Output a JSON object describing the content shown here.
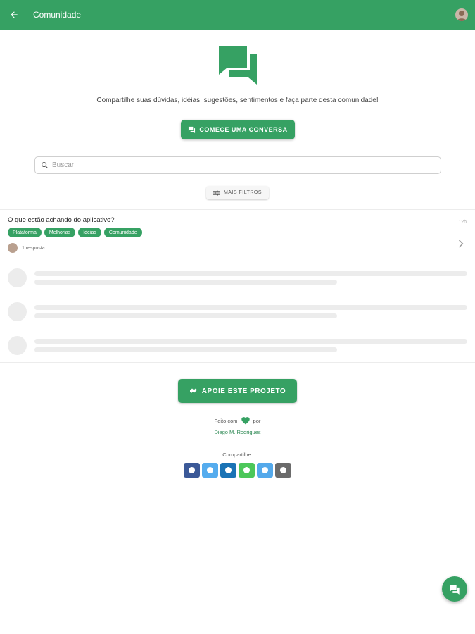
{
  "appbar": {
    "title": "Comunidade"
  },
  "hero": {
    "tagline": "Compartilhe suas dúvidas, idéias, sugestões, sentimentos e faça parte desta comunidade!"
  },
  "actions": {
    "start_label": "COMECE UMA CONVERSA",
    "filters_label": "MAIS FILTROS"
  },
  "search": {
    "placeholder": "Buscar"
  },
  "post": {
    "title": "O que estão achando do aplicativo?",
    "time": "12h",
    "tags": [
      "Plataforma",
      "Melhorias",
      "Ideias",
      "Comunidade"
    ],
    "replies": "1 resposta"
  },
  "footer": {
    "support_label": "APOIE ESTE PROJETO",
    "made_with": "Feito com",
    "by": "por",
    "author": "Diego M. Rodrigues",
    "share_label": "Compartilhe:"
  },
  "share_buttons": [
    {
      "name": "facebook-icon",
      "color": "#3b5998"
    },
    {
      "name": "twitter-icon",
      "color": "#55acee"
    },
    {
      "name": "linkedin-icon",
      "color": "#1a73b5"
    },
    {
      "name": "whatsapp-icon",
      "color": "#4cc75a"
    },
    {
      "name": "telegram-icon",
      "color": "#54a9eb"
    },
    {
      "name": "email-icon",
      "color": "#6b6b6b"
    }
  ],
  "colors": {
    "primary": "#36a163",
    "skeleton": "#ececec"
  }
}
